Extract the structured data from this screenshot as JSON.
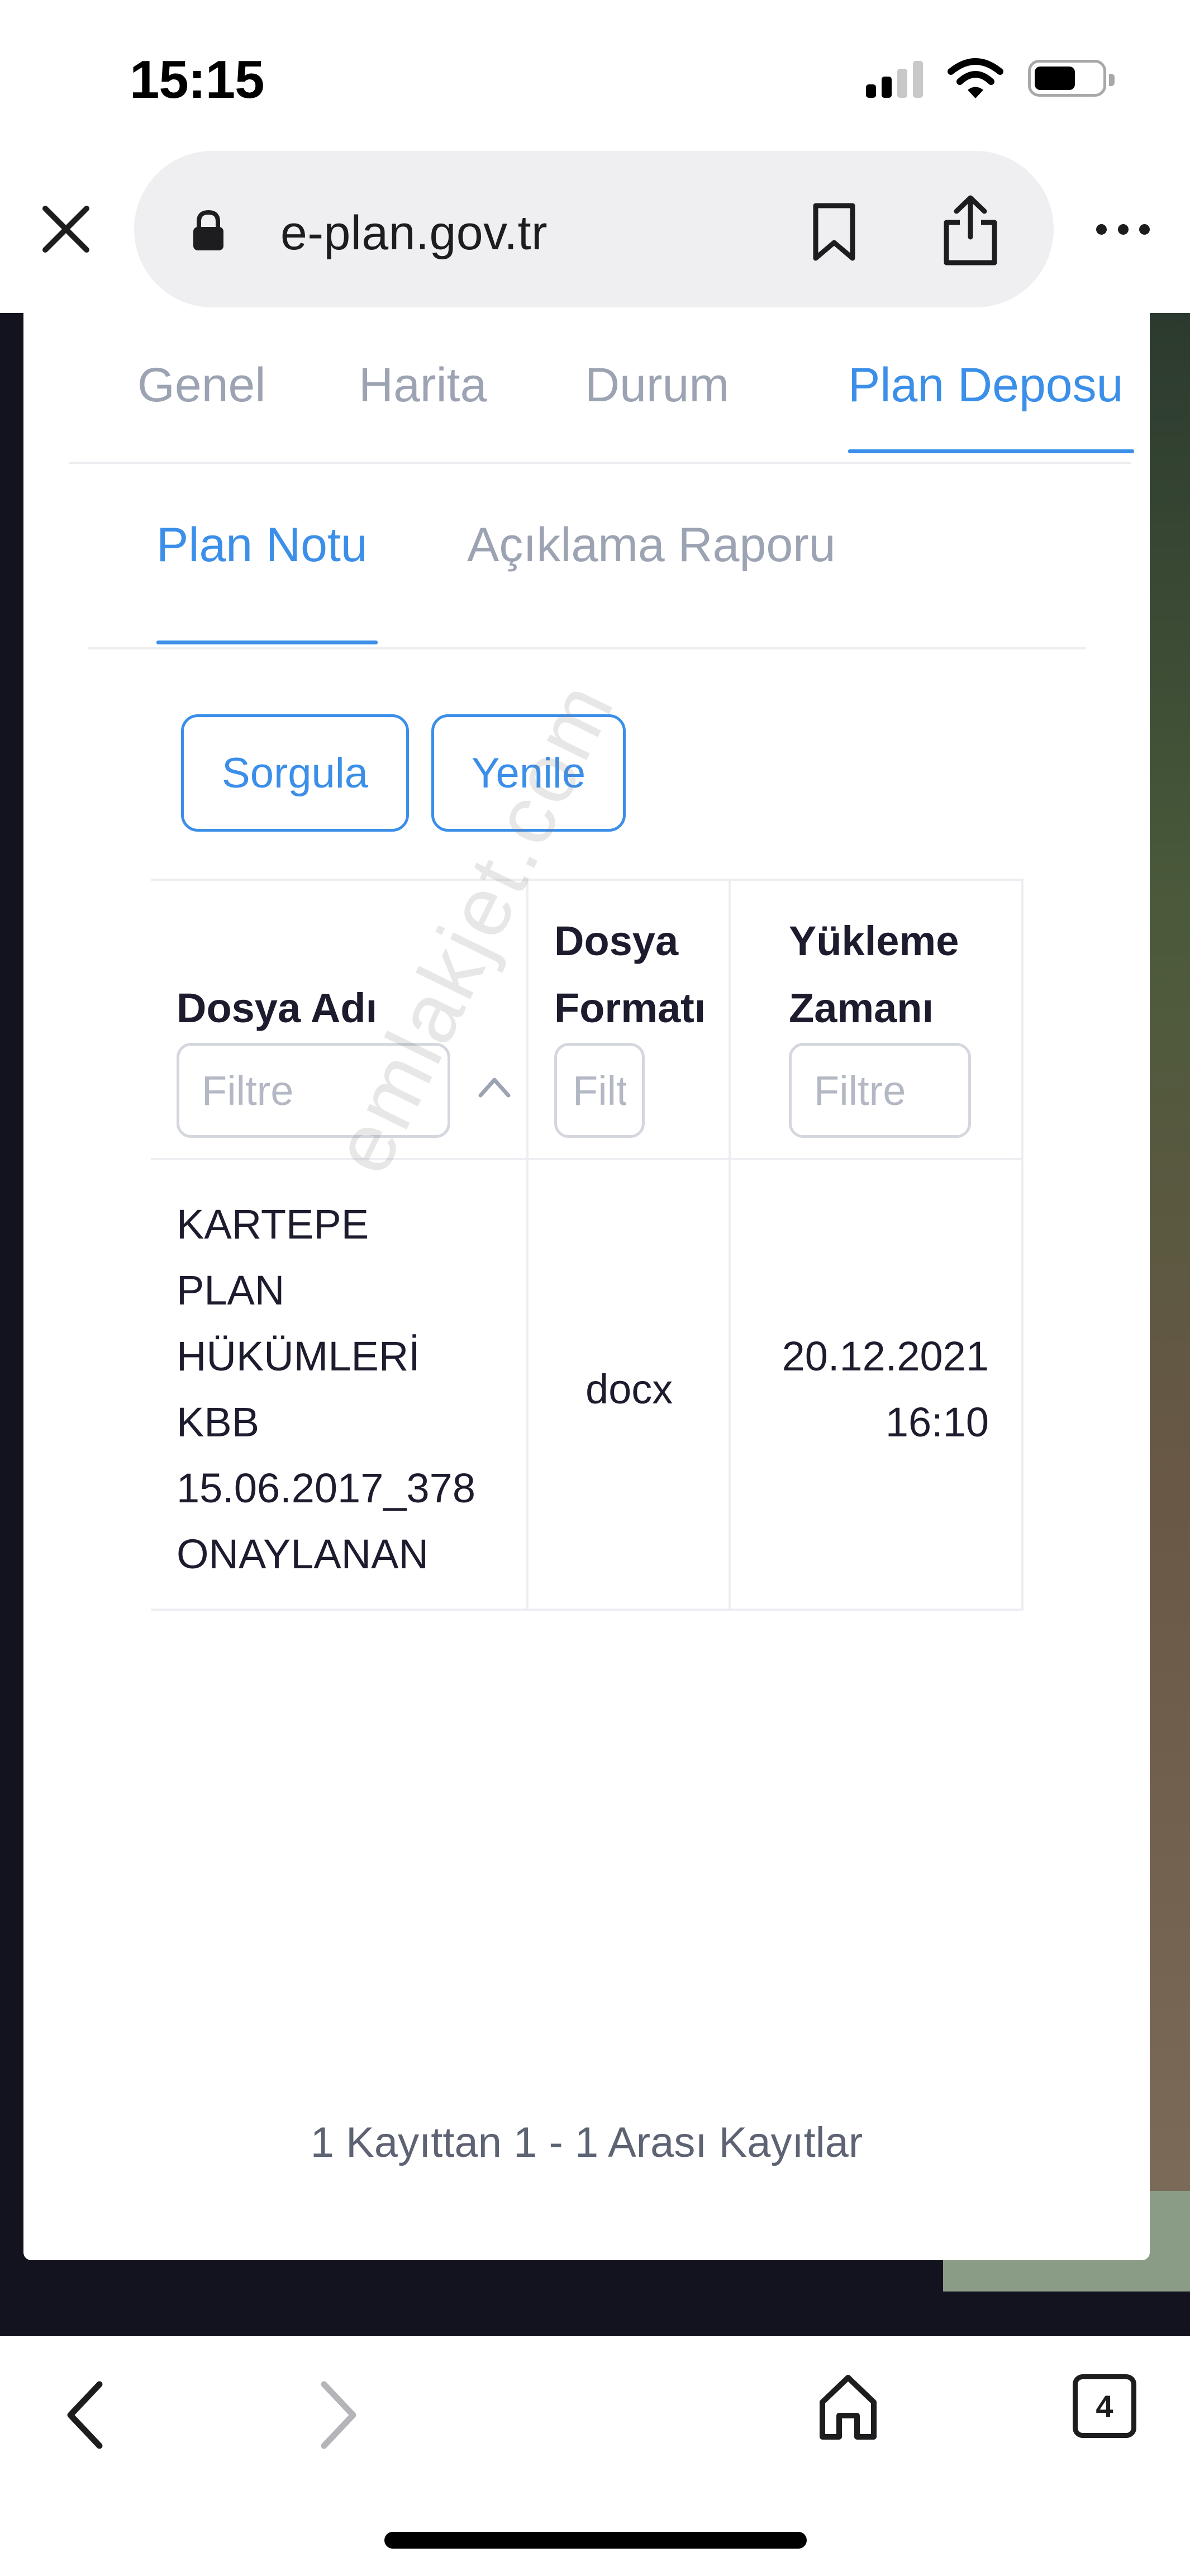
{
  "status_bar": {
    "time": "15:15",
    "signal_icon": "cellular-signal-icon",
    "wifi_icon": "wifi-icon",
    "battery_icon": "battery-icon"
  },
  "browser": {
    "url": "e-plan.gov.tr",
    "close_icon": "close-icon",
    "lock_icon": "lock-icon",
    "bookmark_icon": "bookmark-icon",
    "share_icon": "share-icon",
    "more_icon": "more-icon"
  },
  "main_tabs": [
    {
      "label": "Genel",
      "active": false
    },
    {
      "label": "Harita",
      "active": false
    },
    {
      "label": "Durum",
      "active": false
    },
    {
      "label": "Plan Deposu",
      "active": true
    }
  ],
  "sub_tabs": [
    {
      "label": "Plan Notu",
      "active": true
    },
    {
      "label": "Açıklama Raporu",
      "active": false
    }
  ],
  "buttons": {
    "sorgula": "Sorgula",
    "yenile": "Yenile"
  },
  "table": {
    "headers": [
      {
        "lines": [
          "Dosya Adı"
        ],
        "filter_placeholder": "Filtre",
        "sorted": "ascending"
      },
      {
        "lines": [
          "Dosya",
          "Formatı"
        ],
        "filter_placeholder": "Filtre"
      },
      {
        "lines": [
          "Yükleme",
          "Zamanı"
        ],
        "filter_placeholder": "Filtre"
      }
    ],
    "rows": [
      {
        "name_lines": [
          "KARTEPE",
          "PLAN",
          "HÜKÜMLERİ",
          "KBB",
          "15.06.2017_378",
          "ONAYLANAN"
        ],
        "format": "docx",
        "upload_date": "20.12.2021",
        "upload_time": "16:10"
      }
    ]
  },
  "pagination": "1 Kayıttan 1 - 1 Arası Kayıtlar",
  "watermark": "emlakjet.com",
  "bottom_toolbar": {
    "back_icon": "back-arrow-icon",
    "forward_icon": "forward-arrow-icon",
    "home_icon": "home-icon",
    "tabs_icon": "tabs-icon",
    "tab_count": "4"
  },
  "colors": {
    "accent": "#3b8fe8",
    "inactive_tab": "#9ca3b3",
    "text": "#1c1c2e",
    "backdrop": "#12131e"
  }
}
